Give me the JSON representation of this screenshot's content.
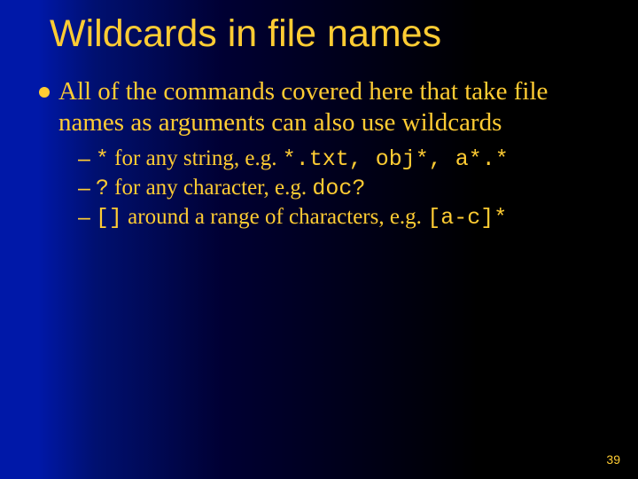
{
  "slide": {
    "title": "Wildcards in file names",
    "page_number": "39"
  },
  "bullet": {
    "text": "All of the commands covered here that take file names as arguments can also use wildcards"
  },
  "sub": [
    {
      "code_lead": "*",
      "text_mid": " for any string, e.g. ",
      "code_tail": "*.txt, obj*, a*.*"
    },
    {
      "code_lead": "?",
      "text_mid": " for any character, e.g. ",
      "code_tail": "doc?"
    },
    {
      "code_lead": "[]",
      "text_mid": " around a range of characters, e.g.  ",
      "code_tail": "[a-c]*"
    }
  ]
}
